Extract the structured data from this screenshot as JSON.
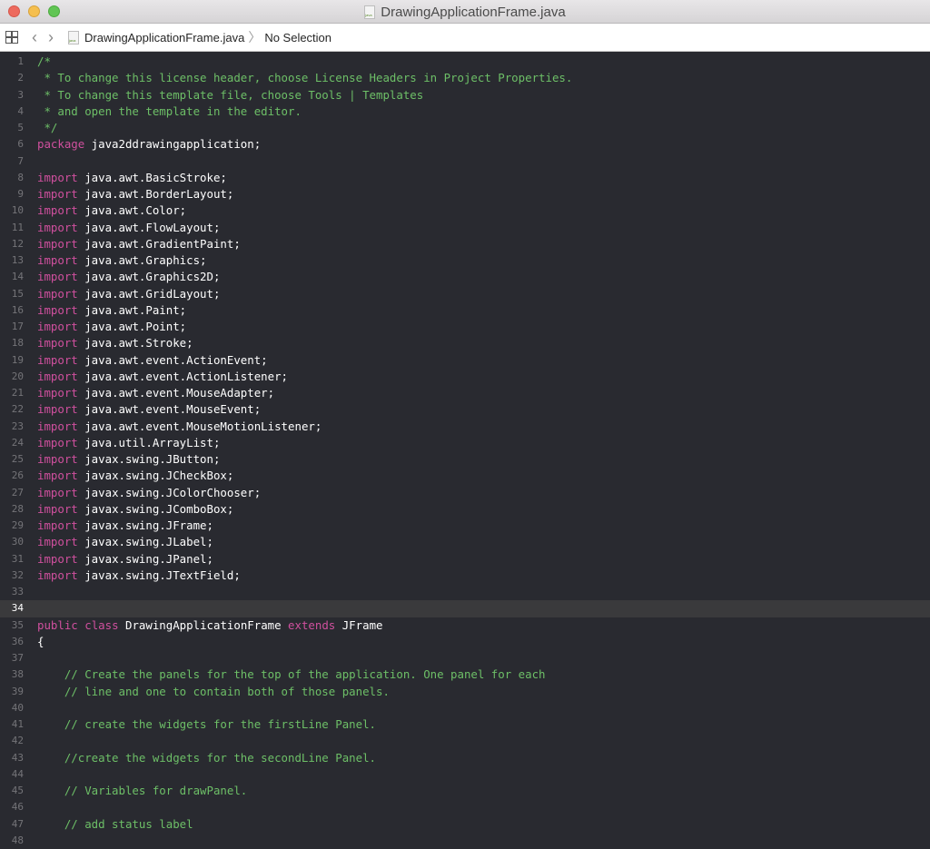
{
  "window": {
    "title": "DrawingApplicationFrame.java",
    "file_icon": "java-file-icon"
  },
  "navbar": {
    "grid_icon": "related-items-grid-icon",
    "back_icon": "chevron-left-icon",
    "forward_icon": "chevron-right-icon",
    "back_label": "‹",
    "forward_label": "›",
    "breadcrumb": {
      "file": "DrawingApplicationFrame.java",
      "separator": "〉",
      "selection": "No Selection"
    }
  },
  "editor": {
    "current_line": 34,
    "colors": {
      "background": "#292a30",
      "comment": "#6dbf67",
      "keyword": "#d0509e",
      "plain": "#ffffff",
      "line_number": "#747478",
      "current_line_bg": "#3a3a3c"
    },
    "lines": [
      {
        "n": "1",
        "tokens": [
          {
            "t": "/*",
            "k": "comment"
          }
        ]
      },
      {
        "n": "2",
        "tokens": [
          {
            "t": " * To change this license header, choose License Headers in Project Properties.",
            "k": "comment"
          }
        ]
      },
      {
        "n": "3",
        "tokens": [
          {
            "t": " * To change this template file, choose Tools | Templates",
            "k": "comment"
          }
        ]
      },
      {
        "n": "4",
        "tokens": [
          {
            "t": " * and open the template in the editor.",
            "k": "comment"
          }
        ]
      },
      {
        "n": "5",
        "tokens": [
          {
            "t": " */",
            "k": "comment"
          }
        ]
      },
      {
        "n": "6",
        "tokens": [
          {
            "t": "package",
            "k": "kw"
          },
          {
            "t": " java2ddrawingapplication;",
            "k": "plain"
          }
        ]
      },
      {
        "n": "7",
        "tokens": []
      },
      {
        "n": "8",
        "tokens": [
          {
            "t": "import",
            "k": "kw"
          },
          {
            "t": " java.awt.BasicStroke;",
            "k": "plain"
          }
        ]
      },
      {
        "n": "9",
        "tokens": [
          {
            "t": "import",
            "k": "kw"
          },
          {
            "t": " java.awt.BorderLayout;",
            "k": "plain"
          }
        ]
      },
      {
        "n": "10",
        "tokens": [
          {
            "t": "import",
            "k": "kw"
          },
          {
            "t": " java.awt.Color;",
            "k": "plain"
          }
        ]
      },
      {
        "n": "11",
        "tokens": [
          {
            "t": "import",
            "k": "kw"
          },
          {
            "t": " java.awt.FlowLayout;",
            "k": "plain"
          }
        ]
      },
      {
        "n": "12",
        "tokens": [
          {
            "t": "import",
            "k": "kw"
          },
          {
            "t": " java.awt.GradientPaint;",
            "k": "plain"
          }
        ]
      },
      {
        "n": "13",
        "tokens": [
          {
            "t": "import",
            "k": "kw"
          },
          {
            "t": " java.awt.Graphics;",
            "k": "plain"
          }
        ]
      },
      {
        "n": "14",
        "tokens": [
          {
            "t": "import",
            "k": "kw"
          },
          {
            "t": " java.awt.Graphics2D;",
            "k": "plain"
          }
        ]
      },
      {
        "n": "15",
        "tokens": [
          {
            "t": "import",
            "k": "kw"
          },
          {
            "t": " java.awt.GridLayout;",
            "k": "plain"
          }
        ]
      },
      {
        "n": "16",
        "tokens": [
          {
            "t": "import",
            "k": "kw"
          },
          {
            "t": " java.awt.Paint;",
            "k": "plain"
          }
        ]
      },
      {
        "n": "17",
        "tokens": [
          {
            "t": "import",
            "k": "kw"
          },
          {
            "t": " java.awt.Point;",
            "k": "plain"
          }
        ]
      },
      {
        "n": "18",
        "tokens": [
          {
            "t": "import",
            "k": "kw"
          },
          {
            "t": " java.awt.Stroke;",
            "k": "plain"
          }
        ]
      },
      {
        "n": "19",
        "tokens": [
          {
            "t": "import",
            "k": "kw"
          },
          {
            "t": " java.awt.event.ActionEvent;",
            "k": "plain"
          }
        ]
      },
      {
        "n": "20",
        "tokens": [
          {
            "t": "import",
            "k": "kw"
          },
          {
            "t": " java.awt.event.ActionListener;",
            "k": "plain"
          }
        ]
      },
      {
        "n": "21",
        "tokens": [
          {
            "t": "import",
            "k": "kw"
          },
          {
            "t": " java.awt.event.MouseAdapter;",
            "k": "plain"
          }
        ]
      },
      {
        "n": "22",
        "tokens": [
          {
            "t": "import",
            "k": "kw"
          },
          {
            "t": " java.awt.event.MouseEvent;",
            "k": "plain"
          }
        ]
      },
      {
        "n": "23",
        "tokens": [
          {
            "t": "import",
            "k": "kw"
          },
          {
            "t": " java.awt.event.MouseMotionListener;",
            "k": "plain"
          }
        ]
      },
      {
        "n": "24",
        "tokens": [
          {
            "t": "import",
            "k": "kw"
          },
          {
            "t": " java.util.ArrayList;",
            "k": "plain"
          }
        ]
      },
      {
        "n": "25",
        "tokens": [
          {
            "t": "import",
            "k": "kw"
          },
          {
            "t": " javax.swing.JButton;",
            "k": "plain"
          }
        ]
      },
      {
        "n": "26",
        "tokens": [
          {
            "t": "import",
            "k": "kw"
          },
          {
            "t": " javax.swing.JCheckBox;",
            "k": "plain"
          }
        ]
      },
      {
        "n": "27",
        "tokens": [
          {
            "t": "import",
            "k": "kw"
          },
          {
            "t": " javax.swing.JColorChooser;",
            "k": "plain"
          }
        ]
      },
      {
        "n": "28",
        "tokens": [
          {
            "t": "import",
            "k": "kw"
          },
          {
            "t": " javax.swing.JComboBox;",
            "k": "plain"
          }
        ]
      },
      {
        "n": "29",
        "tokens": [
          {
            "t": "import",
            "k": "kw"
          },
          {
            "t": " javax.swing.JFrame;",
            "k": "plain"
          }
        ]
      },
      {
        "n": "30",
        "tokens": [
          {
            "t": "import",
            "k": "kw"
          },
          {
            "t": " javax.swing.JLabel;",
            "k": "plain"
          }
        ]
      },
      {
        "n": "31",
        "tokens": [
          {
            "t": "import",
            "k": "kw"
          },
          {
            "t": " javax.swing.JPanel;",
            "k": "plain"
          }
        ]
      },
      {
        "n": "32",
        "tokens": [
          {
            "t": "import",
            "k": "kw"
          },
          {
            "t": " javax.swing.JTextField;",
            "k": "plain"
          }
        ]
      },
      {
        "n": "33",
        "tokens": []
      },
      {
        "n": "34",
        "tokens": []
      },
      {
        "n": "35",
        "tokens": [
          {
            "t": "public",
            "k": "kw"
          },
          {
            "t": " ",
            "k": "plain"
          },
          {
            "t": "class",
            "k": "kw"
          },
          {
            "t": " DrawingApplicationFrame ",
            "k": "plain"
          },
          {
            "t": "extends",
            "k": "kw"
          },
          {
            "t": " JFrame",
            "k": "plain"
          }
        ]
      },
      {
        "n": "36",
        "tokens": [
          {
            "t": "{",
            "k": "plain"
          }
        ]
      },
      {
        "n": "37",
        "tokens": []
      },
      {
        "n": "38",
        "tokens": [
          {
            "t": "    // Create the panels for the top of the application. One panel for each",
            "k": "comment"
          }
        ]
      },
      {
        "n": "39",
        "tokens": [
          {
            "t": "    // line and one to contain both of those panels.",
            "k": "comment"
          }
        ]
      },
      {
        "n": "40",
        "tokens": []
      },
      {
        "n": "41",
        "tokens": [
          {
            "t": "    // create the widgets for the firstLine Panel.",
            "k": "comment"
          }
        ]
      },
      {
        "n": "42",
        "tokens": []
      },
      {
        "n": "43",
        "tokens": [
          {
            "t": "    //create the widgets for the secondLine Panel.",
            "k": "comment"
          }
        ]
      },
      {
        "n": "44",
        "tokens": []
      },
      {
        "n": "45",
        "tokens": [
          {
            "t": "    // Variables for drawPanel.",
            "k": "comment"
          }
        ]
      },
      {
        "n": "46",
        "tokens": []
      },
      {
        "n": "47",
        "tokens": [
          {
            "t": "    // add status label",
            "k": "comment"
          }
        ]
      },
      {
        "n": "48",
        "tokens": []
      }
    ]
  }
}
